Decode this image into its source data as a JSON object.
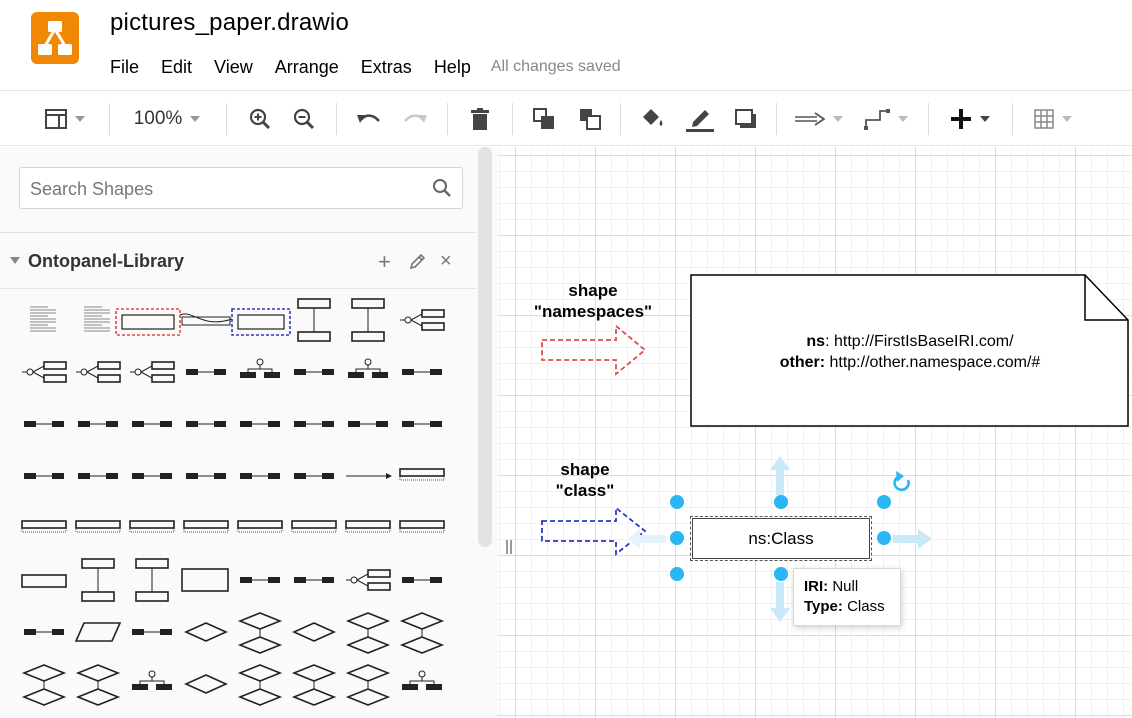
{
  "app": {
    "document_title": "pictures_paper.drawio",
    "logo_icon": "drawio-logo-icon",
    "brand_color": "#f08705"
  },
  "menu": {
    "items": [
      "File",
      "Edit",
      "View",
      "Arrange",
      "Extras",
      "Help"
    ],
    "status": "All changes saved"
  },
  "toolbar": {
    "zoom": "100%",
    "icons": [
      "format-panel-icon",
      "zoom-in-icon",
      "zoom-out-icon",
      "undo-icon",
      "redo-icon",
      "delete-icon",
      "to-front-icon",
      "to-back-icon",
      "fill-color-icon",
      "line-color-icon",
      "shadow-icon",
      "connection-arrow-icon",
      "waypoints-icon",
      "insert-plus-icon",
      "table-icon"
    ]
  },
  "sidebar": {
    "search_placeholder": "Search Shapes",
    "library": {
      "title": "Ontopanel-Library",
      "add_symbol": "+",
      "close_symbol": "×"
    }
  },
  "canvas": {
    "shape_namespaces_label": [
      "shape",
      "\"namespaces\""
    ],
    "shape_class_label": [
      "shape",
      "\"class\""
    ],
    "namespaces_note": {
      "lines": [
        {
          "key": "ns",
          "value": ": http://FirstIsBaseIRI.com/"
        },
        {
          "key": "other:",
          "value": " http://other.namespace.com/#"
        }
      ]
    },
    "class_box": {
      "label": "ns:Class"
    },
    "tooltip": {
      "iri_key": "IRI:",
      "iri_value": " Null",
      "type_key": "Type:",
      "type_value": " Class"
    },
    "colors": {
      "namespaces_arrow": "#e34a4a",
      "class_arrow": "#2b3ac4",
      "selection_handle": "#29b6f2",
      "hover_arrow": "#c9e8f8"
    }
  }
}
